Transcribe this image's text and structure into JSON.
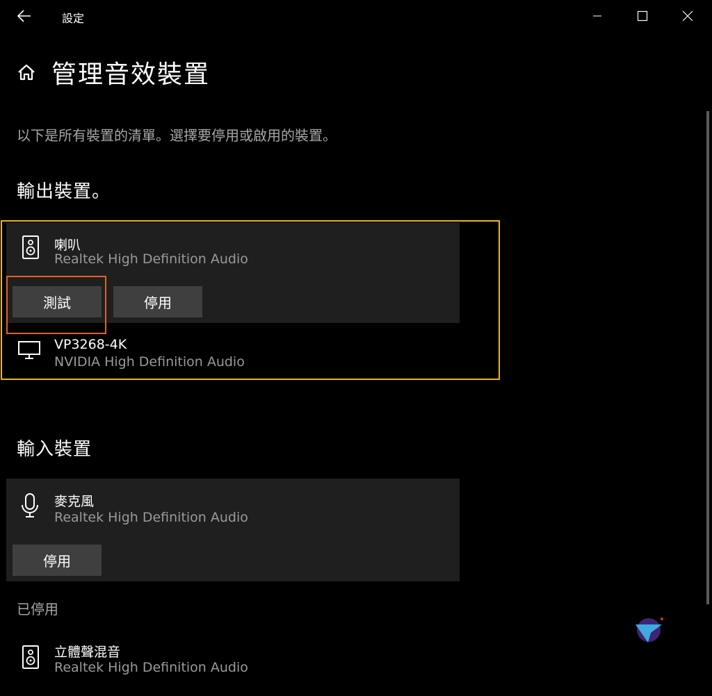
{
  "titlebar": {
    "title": "設定"
  },
  "page": {
    "title": "管理音效裝置",
    "description": "以下是所有裝置的清單。選擇要停用或啟用的裝置。"
  },
  "output": {
    "heading": "輸出裝置。",
    "devices": [
      {
        "name": "喇叭",
        "driver": "Realtek High Definition Audio",
        "test_label": "測試",
        "disable_label": "停用",
        "icon": "speaker-icon"
      },
      {
        "name": "VP3268-4K",
        "driver": "NVIDIA High Definition Audio",
        "icon": "monitor-icon"
      }
    ]
  },
  "input": {
    "heading": "輸入裝置",
    "devices": [
      {
        "name": "麥克風",
        "driver": "Realtek High Definition Audio",
        "disable_label": "停用",
        "icon": "microphone-icon"
      }
    ]
  },
  "disabled": {
    "heading": "已停用",
    "devices": [
      {
        "name": "立體聲混音",
        "driver": "Realtek High Definition Audio",
        "icon": "speaker-icon"
      }
    ]
  },
  "colors": {
    "highlight_yellow": "#e8b81f",
    "highlight_orange": "#e0622a",
    "card": "#1f1f1f",
    "button": "#3f3f3f"
  }
}
